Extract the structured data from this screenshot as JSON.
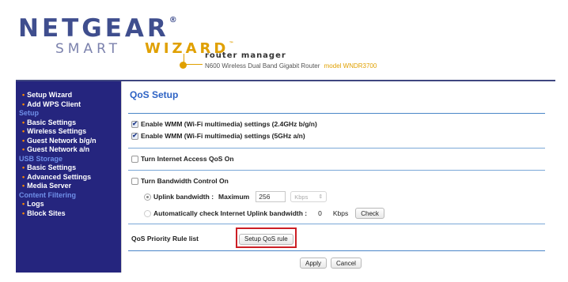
{
  "header": {
    "brand": "NETGEAR",
    "brand_mark": "®",
    "smart": "SMART",
    "wizard": "WIZARD",
    "wizard_mark": "™",
    "product_title": "router manager",
    "product_desc": "N600 Wireless Dual Band Gigabit Router",
    "model": "model WNDR3700"
  },
  "sidebar": {
    "entries": [
      {
        "label": "Setup Wizard",
        "kind": "item"
      },
      {
        "label": "Add WPS Client",
        "kind": "item"
      },
      {
        "label": "Setup",
        "kind": "section"
      },
      {
        "label": "Basic Settings",
        "kind": "item"
      },
      {
        "label": "Wireless Settings",
        "kind": "item"
      },
      {
        "label": "Guest Network b/g/n",
        "kind": "item"
      },
      {
        "label": "Guest Network a/n",
        "kind": "item"
      },
      {
        "label": "USB Storage",
        "kind": "section"
      },
      {
        "label": "Basic Settings",
        "kind": "item"
      },
      {
        "label": "Advanced Settings",
        "kind": "item"
      },
      {
        "label": "Media Server",
        "kind": "item"
      },
      {
        "label": "Content Filtering",
        "kind": "section"
      },
      {
        "label": "Logs",
        "kind": "item"
      },
      {
        "label": "Block Sites",
        "kind": "item"
      }
    ]
  },
  "main": {
    "title": "QoS Setup",
    "wmm_24": {
      "label": "Enable WMM (Wi-Fi multimedia) settings (2.4GHz b/g/n)",
      "checked": true
    },
    "wmm_5": {
      "label": "Enable WMM (Wi-Fi multimedia) settings (5GHz a/n)",
      "checked": true
    },
    "internet_qos": {
      "label": "Turn Internet Access QoS On",
      "checked": false
    },
    "bandwidth_control": {
      "label": "Turn Bandwidth Control On",
      "checked": false
    },
    "uplink": {
      "label": "Uplink bandwidth :",
      "max_label": "Maximum",
      "value": "256",
      "unit": "Kbps"
    },
    "auto_check": {
      "label": "Automatically check Internet Uplink bandwidth :",
      "value": "0",
      "unit": "Kbps",
      "button": "Check"
    },
    "priority_rule": {
      "label": "QoS Priority Rule list",
      "button": "Setup QoS rule"
    },
    "apply": "Apply",
    "cancel": "Cancel"
  },
  "colors": {
    "sidebar_bg": "#25257e",
    "accent": "#2d62c4",
    "highlight": "#cc1f25",
    "brand": "#3f4e8e",
    "wizard": "#e0a000"
  }
}
